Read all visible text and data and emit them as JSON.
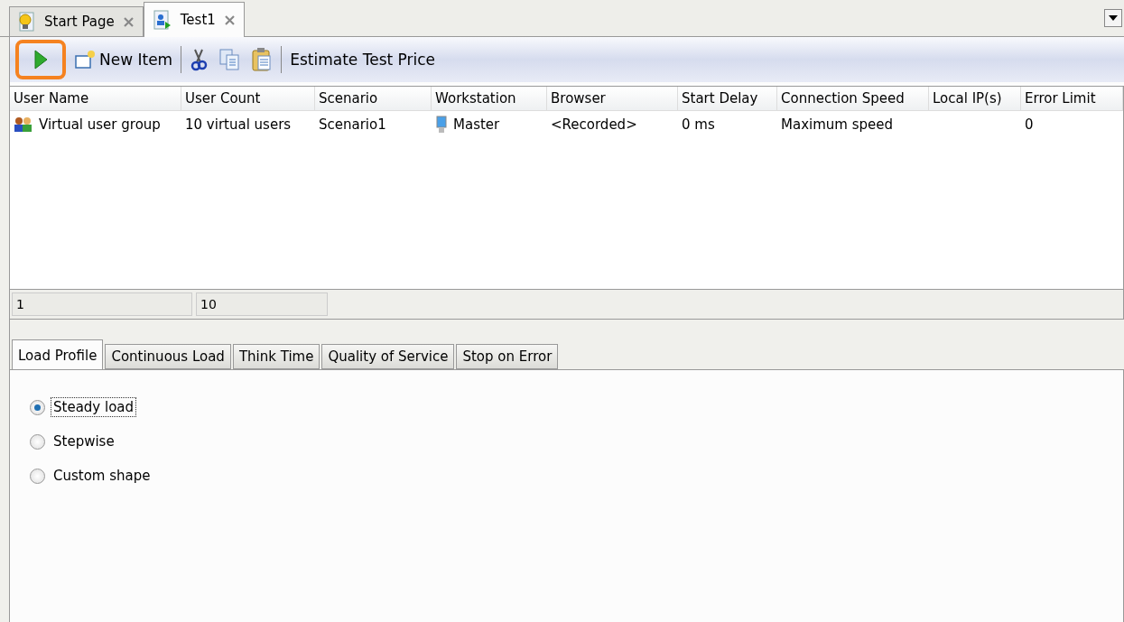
{
  "doc_tabs": [
    {
      "label": "Start Page",
      "kind": "start",
      "selected": false
    },
    {
      "label": "Test1",
      "kind": "test",
      "selected": true
    }
  ],
  "toolbar": {
    "items": [
      {
        "kind": "run",
        "highlighted": true
      },
      {
        "kind": "new",
        "label": "New Item"
      },
      {
        "kind": "sep"
      },
      {
        "kind": "cut"
      },
      {
        "kind": "copy"
      },
      {
        "kind": "paste"
      },
      {
        "kind": "sep"
      },
      {
        "kind": "text",
        "label": "Estimate Test Price"
      }
    ]
  },
  "table": {
    "columns": [
      "User Name",
      "User Count",
      "Scenario",
      "Workstation",
      "Browser",
      "Start Delay",
      "Connection Speed",
      "Local IP(s)",
      "Error Limit"
    ],
    "rows": [
      {
        "cells": [
          "Virtual user group",
          "10 virtual users",
          "Scenario1",
          "Master",
          "<Recorded>",
          "0 ms",
          "Maximum speed",
          "",
          "0"
        ]
      }
    ],
    "footer": [
      "1",
      "10"
    ]
  },
  "settings_tabs": [
    {
      "label": "Load Profile",
      "selected": true
    },
    {
      "label": "Continuous Load",
      "selected": false
    },
    {
      "label": "Think Time",
      "selected": false
    },
    {
      "label": "Quality of Service",
      "selected": false
    },
    {
      "label": "Stop on Error",
      "selected": false
    }
  ],
  "load_profile": [
    {
      "label": "Steady load",
      "selected": true
    },
    {
      "label": "Stepwise",
      "selected": false
    },
    {
      "label": "Custom shape",
      "selected": false
    }
  ]
}
